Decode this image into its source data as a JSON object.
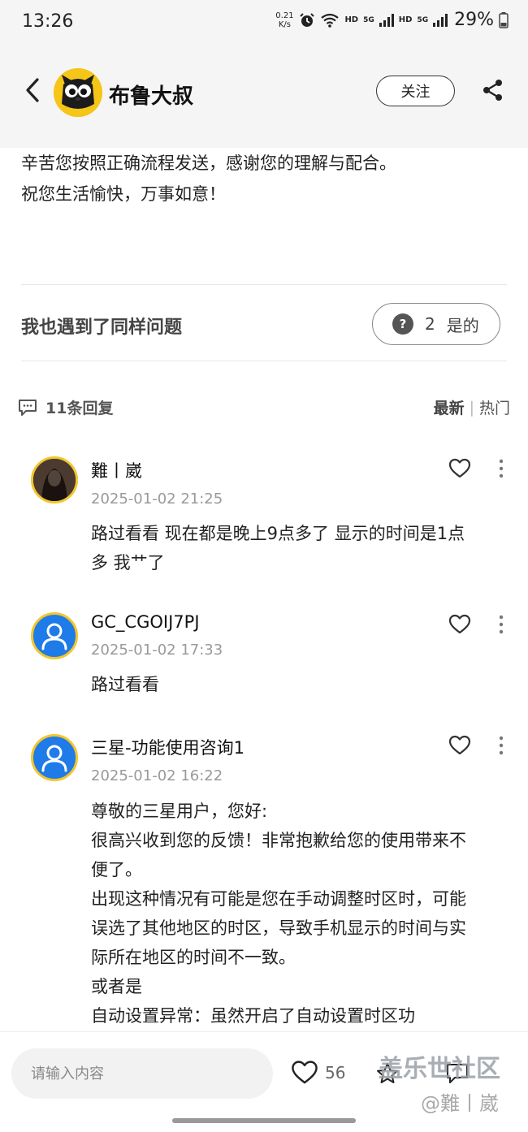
{
  "status": {
    "time": "13:26",
    "speed_value": "0.21",
    "speed_unit": "K/s",
    "hd1": "HD",
    "net1": "5G",
    "hd2": "HD",
    "net2": "5G",
    "battery": "29%"
  },
  "header": {
    "author": "布鲁大叔",
    "follow_label": "关注"
  },
  "post": {
    "line1": "辛苦您按照正确流程发送，感谢您的理解与配合。",
    "line2": "祝您生活愉快，万事如意！"
  },
  "same_issue": {
    "label": "我也遇到了同样问题",
    "count": "2",
    "button_label": "是的"
  },
  "replies": {
    "count_label": "11条回复",
    "sort_latest": "最新",
    "sort_separator": "|",
    "sort_hot": "热门"
  },
  "comments": [
    {
      "name": "難丨崴",
      "time": "2025-01-02 21:25",
      "text": "路过看看 现在都是晚上9点多了 显示的时间是1点多 我艹了"
    },
    {
      "name": "GC_CGOIJ7PJ",
      "time": "2025-01-02 17:33",
      "text": "路过看看"
    },
    {
      "name": "三星-功能使用咨询1",
      "time": "2025-01-02 16:22",
      "text": "尊敬的三星用户，您好:\n很高兴收到您的反馈！非常抱歉给您的使用带来不便了。\n出现这种情况有可能是您在手动调整时区时，可能误选了其他地区的时区，导致手机显示的时间与实际所在地区的时间不一致。\n或者是\n自动设置异常：虽然开启了自动设置时区功"
    }
  ],
  "bottom": {
    "input_placeholder": "请输入内容",
    "like_count": "56",
    "watermark_line1": "盖乐世社区",
    "watermark_line2": "@難丨崴"
  }
}
